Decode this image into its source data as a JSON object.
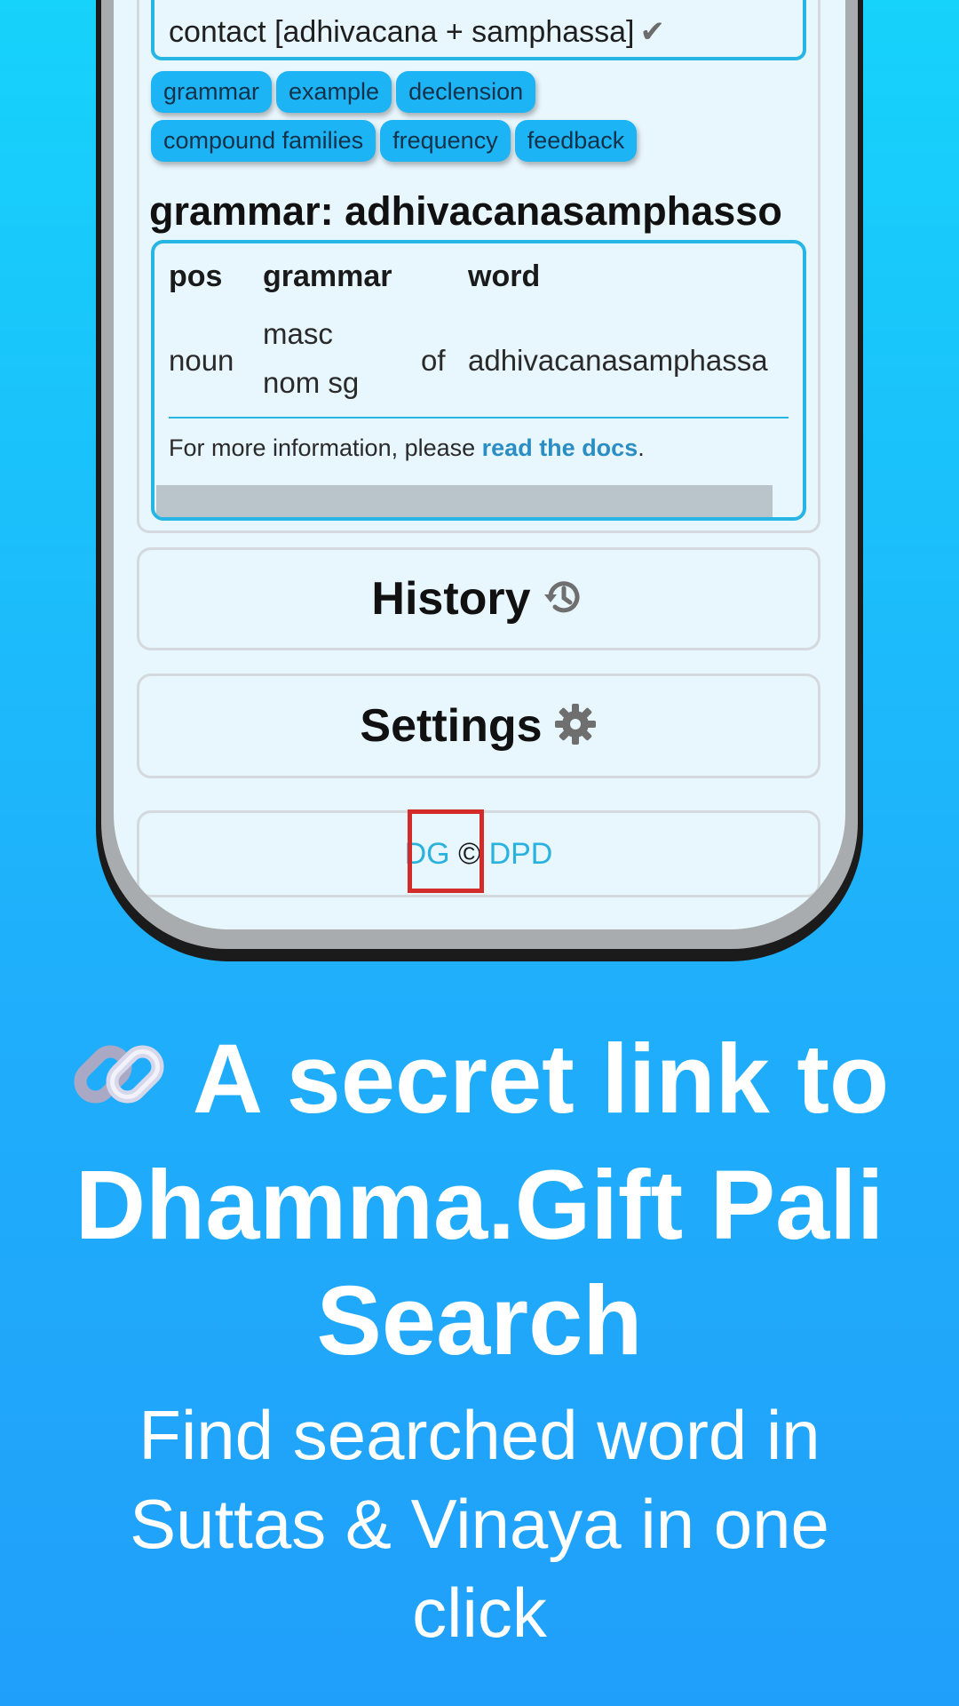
{
  "contact": {
    "text": "contact [adhivacana + samphassa]",
    "check": "✔"
  },
  "chips_row1": [
    "grammar",
    "example",
    "declension"
  ],
  "chips_row2": [
    "compound families",
    "frequency",
    "feedback"
  ],
  "grammar": {
    "heading": "grammar: adhivacanasamphasso",
    "headers": {
      "pos": "pos",
      "grammar": "grammar",
      "word": "word"
    },
    "row": {
      "pos": "noun",
      "grammar_line1": "masc",
      "grammar_line2": "nom sg",
      "of": "of",
      "word": "adhivacanasamphassa"
    },
    "note_prefix": "For more information, please ",
    "note_link": "read the docs",
    "note_suffix": "."
  },
  "buttons": {
    "history": "History",
    "settings": "Settings"
  },
  "footer": {
    "dg": "DG",
    "copyright": "©",
    "dpd": "DPD"
  },
  "promo": {
    "title_line1": "A secret link to",
    "title_line2": "Dhamma.Gift Pali",
    "title_line3": "Search",
    "subtitle_line1": "Find searched word in",
    "subtitle_line2": "Suttas & Vinaya in one",
    "subtitle_line3": "click"
  },
  "icons": {
    "history": "history-icon",
    "settings": "gear-icon",
    "link": "link-icon"
  },
  "colors": {
    "accent": "#27b6e4",
    "chip": "#1db4f6",
    "highlight": "#d32a2a",
    "background_top": "#16d3fb",
    "background_bottom": "#209ffa"
  }
}
